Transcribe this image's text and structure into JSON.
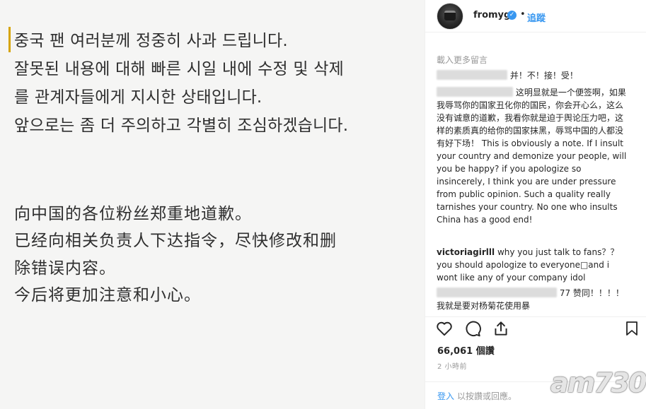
{
  "image_text": {
    "korean": [
      "중국 팬 여러분께 정중히 사과 드립니다.",
      "잘못된 내용에 대해 빠른 시일 내에 수정 및 삭제",
      "를 관계자들에게 지시한 상태입니다.",
      "앞으로는 좀 더 주의하고 각별히 조심하겠습니다."
    ],
    "chinese": [
      "向中国的各位粉丝郑重地道歉。",
      "已经向相关负责人下达指令，尽快修改和删",
      "除错误内容。",
      "今后将更加注意和小心。"
    ]
  },
  "header": {
    "username": "fromyg",
    "verified_icon": "verified-check-icon",
    "separator": "•",
    "follow_label": "追蹤"
  },
  "comments": {
    "load_more": "載入更多留言",
    "items": [
      {
        "user": "",
        "text": "并！不！接！受！"
      },
      {
        "user": "",
        "text": "这明显就是一个便签啊，如果我辱骂你的国家丑化你的国民，你会开心么，这么没有诚意的道歉，我看你就是迫于舆论压力吧，这样的素质真的给你的国家抹黑，辱骂中国的人都没有好下场！ This is obviously a note. If I insult your country and demonize your people, will you be happy? if you apologize so insincerely, I think you are under pressure from public opinion. Such a quality really tarnishes your country. No one who insults China has a good end!"
      },
      {
        "user": "victoriagirlll",
        "text": "why you just talk to fans？？ you should apologize to everyone□and i wont like any of your company idol"
      },
      {
        "user": "",
        "text": "77 赞同！！！！我就是要对杨菊花使用暴"
      }
    ]
  },
  "actions": {
    "like_icon": "heart-icon",
    "comment_icon": "comment-bubble-icon",
    "share_icon": "share-icon",
    "save_icon": "bookmark-icon"
  },
  "likes": "66,061 個讚",
  "timestamp": "2 小時前",
  "login": {
    "link": "登入",
    "suffix": "以按讚或回應。"
  },
  "watermark": "am730",
  "colors": {
    "link_blue": "#3897f0",
    "text_dark": "#262626",
    "muted_gray": "#999999",
    "image_bg": "#f5f5f4",
    "cursor_bar": "#d6a400"
  }
}
